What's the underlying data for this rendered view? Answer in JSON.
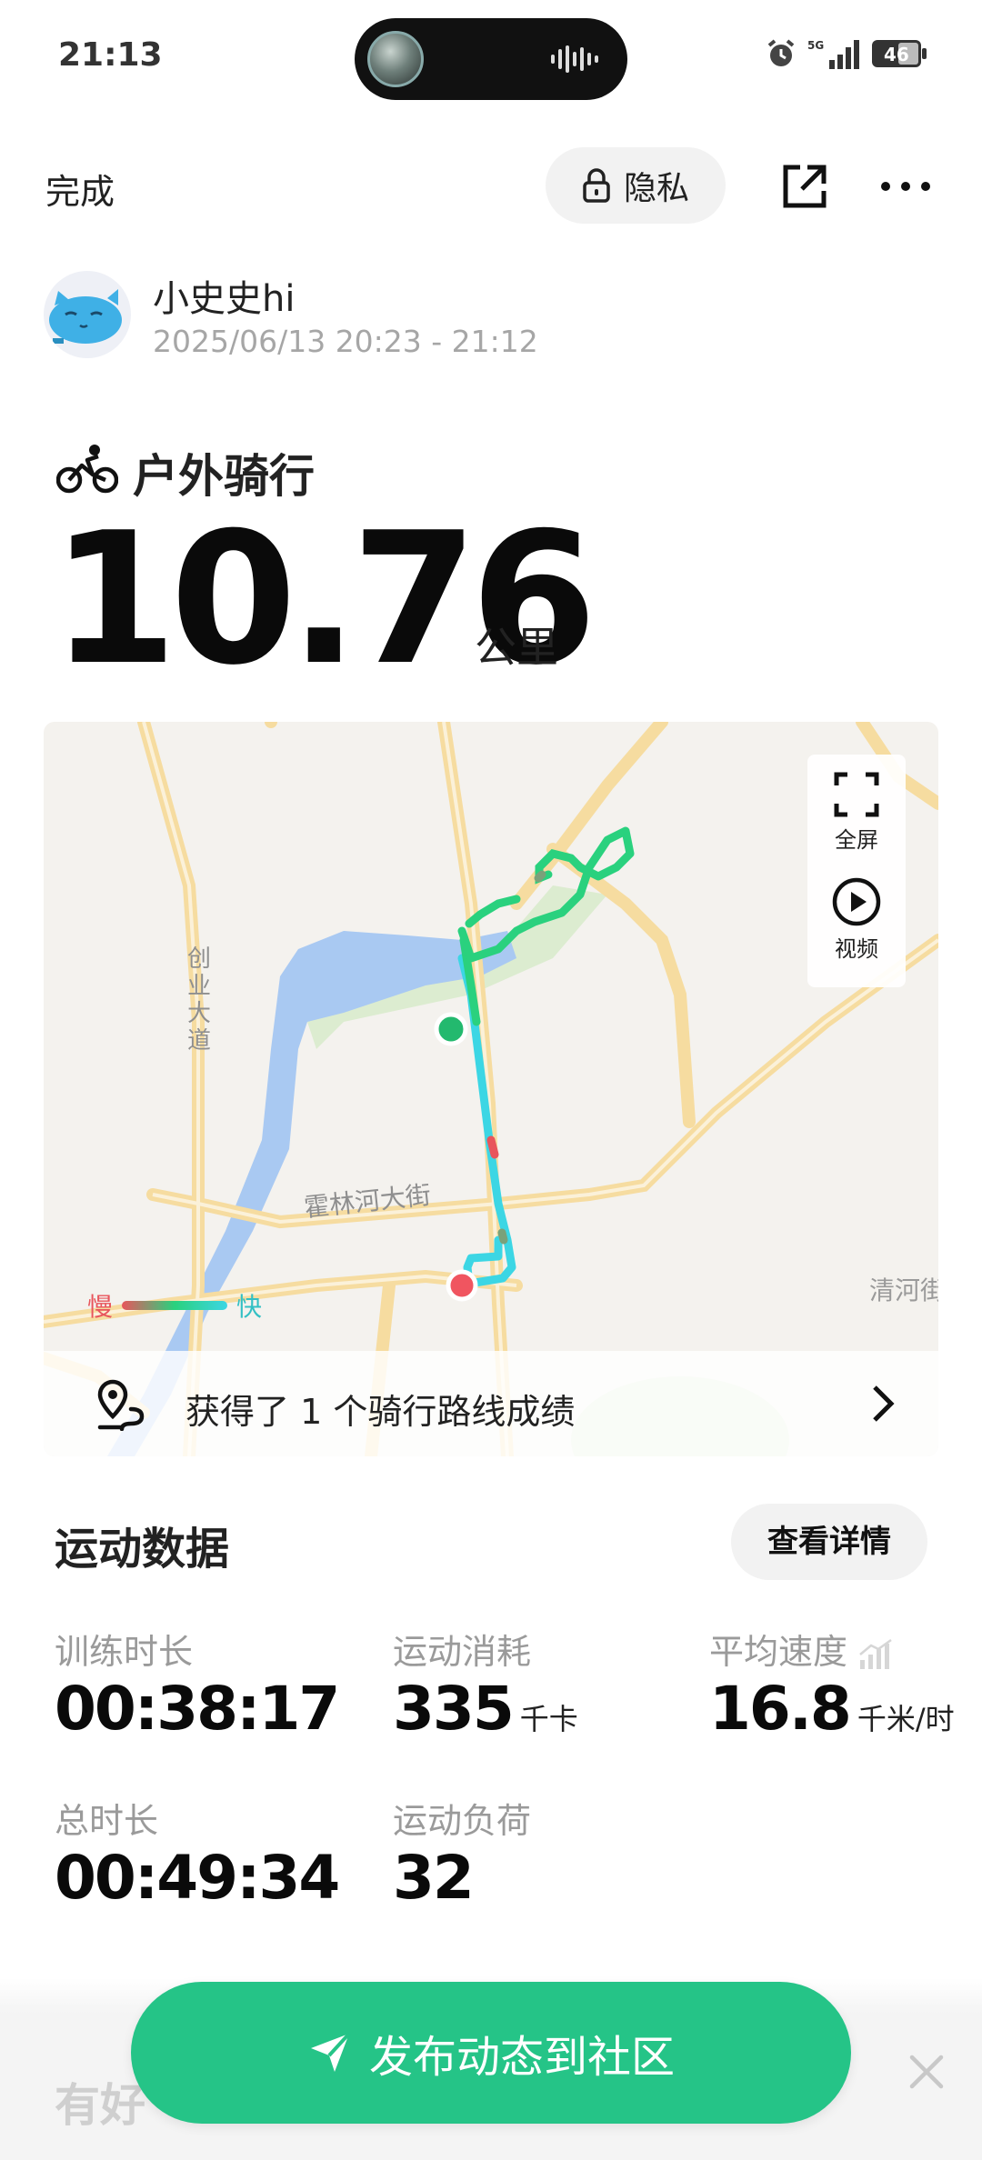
{
  "status_bar": {
    "time": "21:13",
    "network": "5G",
    "battery": "46"
  },
  "top_bar": {
    "done_label": "完成",
    "privacy_label": "隐私"
  },
  "user": {
    "name": "小史史hi",
    "time_range": "2025/06/13 20:23 - 21:12"
  },
  "activity": {
    "type": "户外骑行",
    "distance": "10.76",
    "distance_unit": "公里"
  },
  "map": {
    "fullscreen_label": "全屏",
    "video_label": "视频",
    "legend_slow": "慢",
    "legend_fast": "快",
    "road_labels": [
      "创业大道",
      "霍林河大街",
      "清河街"
    ],
    "achievement_text": "获得了 1 个骑行路线成绩",
    "colors": {
      "route": "#2ad17e",
      "route_fast": "#3cd6e4",
      "start": "#23b96e",
      "end": "#f05560",
      "water": "#a9c9f2",
      "road": "#f6dca0"
    }
  },
  "stats": {
    "title": "运动数据",
    "detail_label": "查看详情",
    "items": [
      {
        "label": "训练时长",
        "value": "00:38:17",
        "unit": ""
      },
      {
        "label": "运动消耗",
        "value": "335",
        "unit": "千卡"
      },
      {
        "label": "平均速度",
        "value": "16.8",
        "unit": "千米/时"
      },
      {
        "label": "总时长",
        "value": "00:49:34",
        "unit": ""
      },
      {
        "label": "运动负荷",
        "value": "32",
        "unit": ""
      }
    ]
  },
  "bottom": {
    "section_peek": "有好",
    "publish_label": "发布动态到社区",
    "accent": "#25c487"
  }
}
